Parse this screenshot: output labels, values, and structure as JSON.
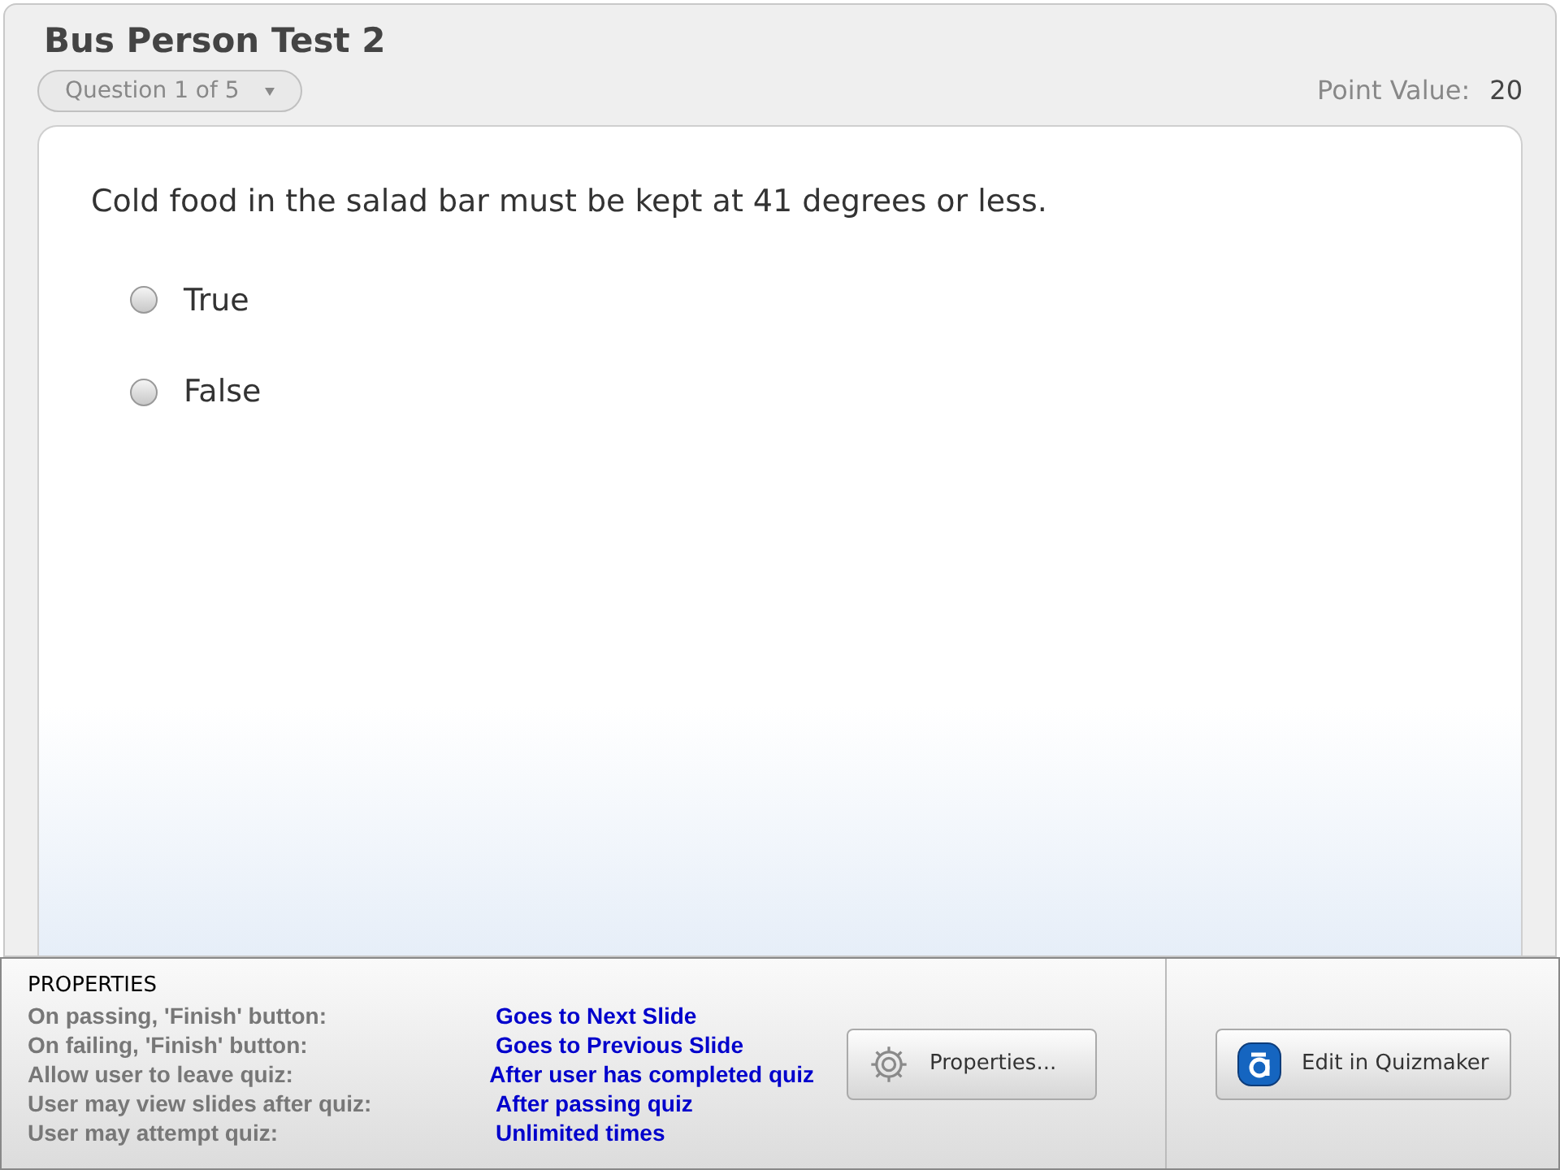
{
  "quiz": {
    "title": "Bus Person Test 2",
    "question_selector": "Question 1 of 5",
    "point_value_label": "Point Value:",
    "point_value": "20"
  },
  "question": {
    "text": "Cold food in the salad bar must be kept at 41 degrees or less.",
    "options": [
      {
        "label": "True",
        "selected": false
      },
      {
        "label": "False",
        "selected": false
      }
    ]
  },
  "properties": {
    "heading": "PROPERTIES",
    "rows": [
      {
        "label": "On passing, 'Finish' button:",
        "value": "Goes to Next Slide"
      },
      {
        "label": "On failing, 'Finish' button:",
        "value": "Goes to Previous Slide"
      },
      {
        "label": "Allow user to leave quiz:",
        "value": "After user has completed quiz"
      },
      {
        "label": "User may view slides after quiz:",
        "value": "After passing quiz"
      },
      {
        "label": "User may attempt quiz:",
        "value": "Unlimited times"
      }
    ],
    "buttons": [
      {
        "kind": "properties",
        "label": "Properties..."
      },
      {
        "kind": "quizmaker",
        "label": "Edit in Quizmaker"
      }
    ]
  }
}
